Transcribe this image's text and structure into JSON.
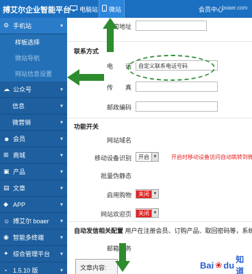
{
  "header": {
    "brand": "搏艾尔企业智能平台",
    "tabs": [
      {
        "label": "电脑站",
        "icon": "monitor-icon"
      },
      {
        "label": "微站",
        "icon": "mobile-icon"
      }
    ],
    "member_link": "会员中心",
    "domain": "boaer.com"
  },
  "sidebar": {
    "group": {
      "label": "手机站",
      "icon": "gear-icon"
    },
    "subitems": [
      "样板选择",
      "微站导航",
      "网站信息设置"
    ],
    "items": [
      {
        "label": "公众号",
        "icon": "chat-icon"
      },
      {
        "label": "信息",
        "icon": ""
      },
      {
        "label": "微营销",
        "icon": ""
      },
      {
        "label": "会员",
        "icon": "users-icon"
      },
      {
        "label": "商城",
        "icon": "cart-icon"
      },
      {
        "label": "产品",
        "icon": "box-icon"
      },
      {
        "label": "文章",
        "icon": "doc-icon"
      },
      {
        "label": "APP",
        "icon": "app-icon"
      },
      {
        "label": "搏艾尔 boaer",
        "icon": "smile-icon"
      },
      {
        "label": "智能多终端",
        "icon": "devices-icon"
      },
      {
        "label": "综合管理平台",
        "icon": "settings-icon"
      },
      {
        "label": "1.5.10 版",
        "icon": "version-icon"
      }
    ]
  },
  "form": {
    "company_addr_label": "公司地址",
    "contact_section": "联系方式",
    "phone_label": "电　　话",
    "phone_value": "自定义联系电话号码",
    "fax_label": "传　　真",
    "postcode_label": "邮政编码",
    "func_section": "功能开关",
    "site_domain_label": "网站域名",
    "mobile_detect_label": "移动设备识别",
    "mobile_detect_value": "开启",
    "mobile_detect_hint": "开启时移动设备访问自动跳转到微",
    "batch_static_label": "批量伪静态",
    "shop_label": "启用购物",
    "shop_value": "关闭",
    "welcome_label": "网站欢迎页",
    "welcome_value": "关闭",
    "notice_title": "自动发信相关配置",
    "notice_text": "用户在注册会员、订购产品、取回密码等，系统会",
    "mail_label": "邮箱服务",
    "article_label": "文章内容:"
  },
  "watermark": {
    "brand_a": "Bai",
    "brand_b": "du",
    "brand_c": "知道"
  },
  "colors": {
    "topbar": "#1b6fc0",
    "sidebar": "#1d5f9f",
    "arrow": "#2e8b2e",
    "alert": "#e62020"
  }
}
